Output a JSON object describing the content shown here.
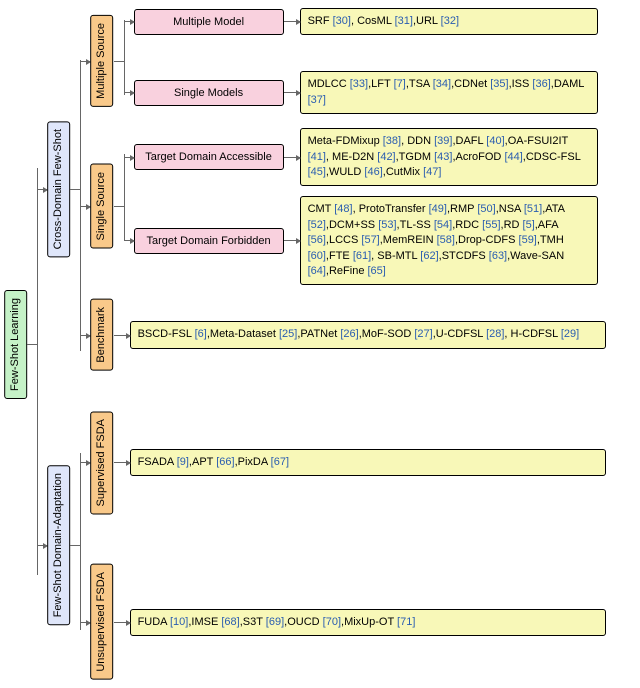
{
  "root": "Few-Shot Learning",
  "l1": {
    "cdfs": "Cross-Domain Few-Shot",
    "fsda": "Few-Shot Domain-Adaptation"
  },
  "cdfs": {
    "multi": "Multiple Source",
    "single": "Single Source",
    "bench": "Benchmark",
    "multi_model": "Multiple Model",
    "single_models": "Single Models",
    "tda": "Target Domain Accessible",
    "tdf": "Target Domain Forbidden"
  },
  "fsda": {
    "sup": "Supervised FSDA",
    "unsup": "Unsupervised FSDA"
  },
  "leaves": {
    "multi_model": [
      {
        "t": "SRF ",
        "r": "[30]"
      },
      {
        "t": ", CosML ",
        "r": "[31]"
      },
      {
        "t": ",URL ",
        "r": "[32]"
      }
    ],
    "single_models": [
      {
        "t": "MDLCC ",
        "r": "[33]"
      },
      {
        "t": ",LFT ",
        "r": "[7]"
      },
      {
        "t": ",TSA ",
        "r": "[34]"
      },
      {
        "t": ",CDNet ",
        "r": "[35]"
      },
      {
        "t": ",ISS ",
        "r": "[36]"
      },
      {
        "t": ",DAML ",
        "r": "[37]"
      }
    ],
    "tda": [
      {
        "t": "Meta-FDMixup ",
        "r": "[38]"
      },
      {
        "t": ", DDN ",
        "r": "[39]"
      },
      {
        "t": ",DAFL ",
        "r": "[40]"
      },
      {
        "t": ",OA-FSUI2IT ",
        "r": "[41]"
      },
      {
        "t": ", ME-D2N ",
        "r": "[42]"
      },
      {
        "t": ",TGDM ",
        "r": "[43]"
      },
      {
        "t": ",AcroFOD ",
        "r": "[44]"
      },
      {
        "t": ",CDSC-FSL ",
        "r": "[45]"
      },
      {
        "t": ",WULD ",
        "r": "[46]"
      },
      {
        "t": ",CutMix ",
        "r": "[47]"
      }
    ],
    "tdf": [
      {
        "t": "CMT ",
        "r": "[48]"
      },
      {
        "t": ", ProtoTransfer ",
        "r": "[49]"
      },
      {
        "t": ",RMP ",
        "r": "[50]"
      },
      {
        "t": ",NSA ",
        "r": "[51]"
      },
      {
        "t": ",ATA ",
        "r": "[52]"
      },
      {
        "t": ",DCM+SS ",
        "r": "[53]"
      },
      {
        "t": ",TL-SS ",
        "r": "[54]"
      },
      {
        "t": ",RDC ",
        "r": "[55]"
      },
      {
        "t": ",RD ",
        "r": "[5]"
      },
      {
        "t": ",AFA ",
        "r": "[56]"
      },
      {
        "t": ",LCCS ",
        "r": "[57]"
      },
      {
        "t": ",MemREIN ",
        "r": "[58]"
      },
      {
        "t": ",Drop-CDFS ",
        "r": "[59]"
      },
      {
        "t": ",TMH ",
        "r": "[60]"
      },
      {
        "t": ",FTE ",
        "r": "[61]"
      },
      {
        "t": ", SB-MTL ",
        "r": "[62]"
      },
      {
        "t": ",STCDFS ",
        "r": "[63]"
      },
      {
        "t": ",Wave-SAN ",
        "r": "[64]"
      },
      {
        "t": ",ReFine ",
        "r": "[65]"
      }
    ],
    "bench": [
      {
        "t": "BSCD-FSL ",
        "r": "[6]"
      },
      {
        "t": ",Meta-Dataset ",
        "r": "[25]"
      },
      {
        "t": ",PATNet ",
        "r": "[26]"
      },
      {
        "t": ",MoF-SOD ",
        "r": "[27]"
      },
      {
        "t": ",U-CDFSL ",
        "r": "[28]"
      },
      {
        "t": ", H-CDFSL ",
        "r": "[29]"
      }
    ],
    "sup": [
      {
        "t": "FSADA ",
        "r": "[9]"
      },
      {
        "t": ",APT ",
        "r": "[66]"
      },
      {
        "t": ",PixDA ",
        "r": "[67]"
      }
    ],
    "unsup": [
      {
        "t": "FUDA ",
        "r": "[10]"
      },
      {
        "t": ",IMSE ",
        "r": "[68]"
      },
      {
        "t": ",S3T ",
        "r": "[69]"
      },
      {
        "t": ",OUCD ",
        "r": "[70]"
      },
      {
        "t": ",MixUp-OT ",
        "r": "[71]"
      }
    ]
  },
  "chart_data": {
    "type": "tree",
    "root": "Few-Shot Learning",
    "children": [
      {
        "name": "Cross-Domain Few-Shot",
        "children": [
          {
            "name": "Multiple Source",
            "children": [
              {
                "name": "Multiple Model",
                "refs": [
                  30,
                  31,
                  32
                ],
                "methods": [
                  "SRF",
                  "CosML",
                  "URL"
                ]
              },
              {
                "name": "Single Models",
                "refs": [
                  33,
                  7,
                  34,
                  35,
                  36,
                  37
                ],
                "methods": [
                  "MDLCC",
                  "LFT",
                  "TSA",
                  "CDNet",
                  "ISS",
                  "DAML"
                ]
              }
            ]
          },
          {
            "name": "Single Source",
            "children": [
              {
                "name": "Target Domain Accessible",
                "refs": [
                  38,
                  39,
                  40,
                  41,
                  42,
                  43,
                  44,
                  45,
                  46,
                  47
                ],
                "methods": [
                  "Meta-FDMixup",
                  "DDN",
                  "DAFL",
                  "OA-FSUI2IT",
                  "ME-D2N",
                  "TGDM",
                  "AcroFOD",
                  "CDSC-FSL",
                  "WULD",
                  "CutMix"
                ]
              },
              {
                "name": "Target Domain Forbidden",
                "refs": [
                  48,
                  49,
                  50,
                  51,
                  52,
                  53,
                  54,
                  55,
                  5,
                  56,
                  57,
                  58,
                  59,
                  60,
                  61,
                  62,
                  63,
                  64,
                  65
                ],
                "methods": [
                  "CMT",
                  "ProtoTransfer",
                  "RMP",
                  "NSA",
                  "ATA",
                  "DCM+SS",
                  "TL-SS",
                  "RDC",
                  "RD",
                  "AFA",
                  "LCCS",
                  "MemREIN",
                  "Drop-CDFS",
                  "TMH",
                  "FTE",
                  "SB-MTL",
                  "STCDFS",
                  "Wave-SAN",
                  "ReFine"
                ]
              }
            ]
          },
          {
            "name": "Benchmark",
            "refs": [
              6,
              25,
              26,
              27,
              28,
              29
            ],
            "methods": [
              "BSCD-FSL",
              "Meta-Dataset",
              "PATNet",
              "MoF-SOD",
              "U-CDFSL",
              "H-CDFSL"
            ]
          }
        ]
      },
      {
        "name": "Few-Shot Domain-Adaptation",
        "children": [
          {
            "name": "Supervised FSDA",
            "refs": [
              9,
              66,
              67
            ],
            "methods": [
              "FSADA",
              "APT",
              "PixDA"
            ]
          },
          {
            "name": "Unsupervised FSDA",
            "refs": [
              10,
              68,
              69,
              70,
              71
            ],
            "methods": [
              "FUDA",
              "IMSE",
              "S3T",
              "OUCD",
              "MixUp-OT"
            ]
          }
        ]
      }
    ]
  }
}
